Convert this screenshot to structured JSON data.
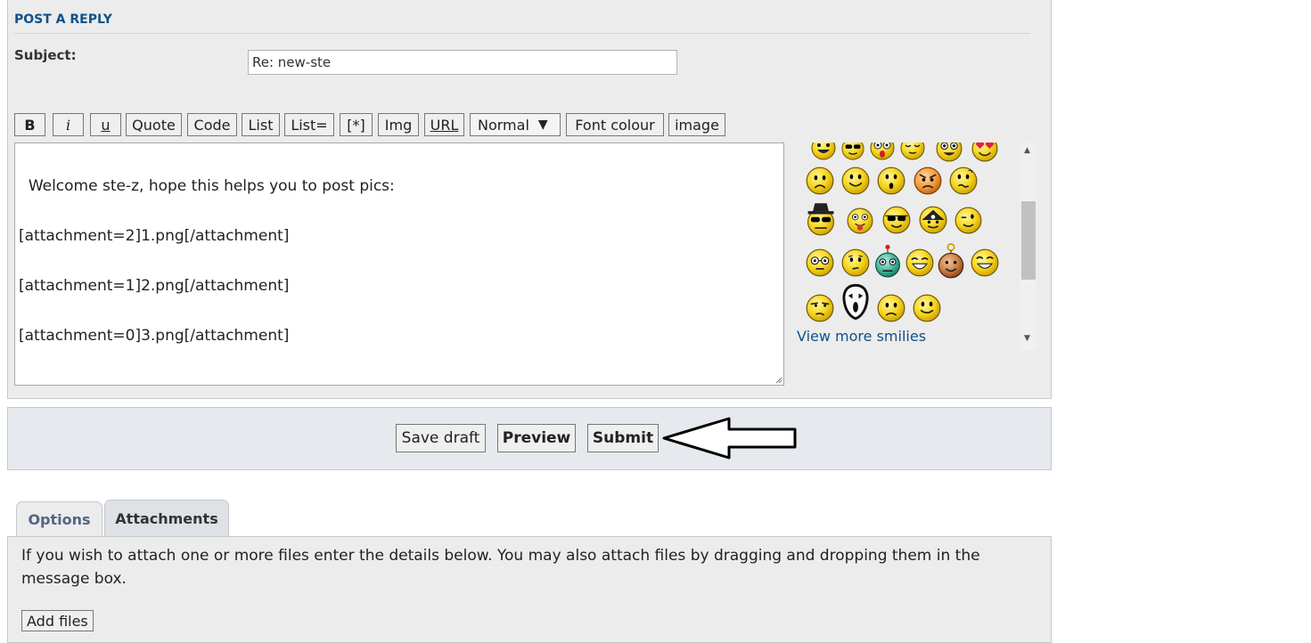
{
  "form": {
    "title": "POST A REPLY",
    "subject_label": "Subject:",
    "subject_value": "Re: new-ste"
  },
  "toolbar": {
    "bold": "B",
    "italic": "i",
    "underline": "u",
    "quote": "Quote",
    "code": "Code",
    "list": "List",
    "list_ordered": "List=",
    "list_item": "[*]",
    "img": "Img",
    "url": "URL",
    "font_size": "Normal",
    "font_colour": "Font colour",
    "image": "image"
  },
  "message": {
    "text": "Welcome ste-z, hope this helps you to post pics:\n\n[attachment=2]1.png[/attachment]\n\n[attachment=1]2.png[/attachment]\n\n[attachment=0]3.png[/attachment]"
  },
  "smilies": {
    "more_link": "View more smilies",
    "icons": [
      "very-happy-smiley-icon",
      "cool-smiley-icon",
      "shocked-smiley-icon",
      "sleepy-smiley-icon",
      "eek-smiley-icon",
      "in-love-smiley-icon",
      "sad-smiley-icon",
      "smile-smiley-icon",
      "surprised-smiley-icon",
      "mad-smiley-icon",
      "confused-smiley-icon",
      "spy-smiley-icon",
      "razz-smiley-icon",
      "sunglasses-smiley-icon",
      "pirate-smiley-icon",
      "wink-smiley-icon",
      "geek-smiley-icon",
      "thinking-smiley-icon",
      "alien-smiley-icon",
      "laughing-smiley-icon",
      "monkey-smiley-icon",
      "grin-smiley-icon",
      "rolleyes-smiley-icon",
      "ghost-smiley-icon",
      "unhappy-smiley-icon",
      "neutral-smiley-icon"
    ]
  },
  "actions": {
    "save_draft": "Save draft",
    "preview": "Preview",
    "submit": "Submit"
  },
  "tabs": [
    {
      "label": "Options"
    },
    {
      "label": "Attachments"
    }
  ],
  "attachments": {
    "instructions": "If you wish to attach one or more files enter the details below. You may also attach files by dragging and dropping them in the message box.",
    "add_files": "Add files"
  },
  "colors": {
    "link_blue": "#105289",
    "panel_bg": "#ececec",
    "submit_bar_bg": "#e6e9ed",
    "smiley_yellow": "#f7d61c"
  }
}
